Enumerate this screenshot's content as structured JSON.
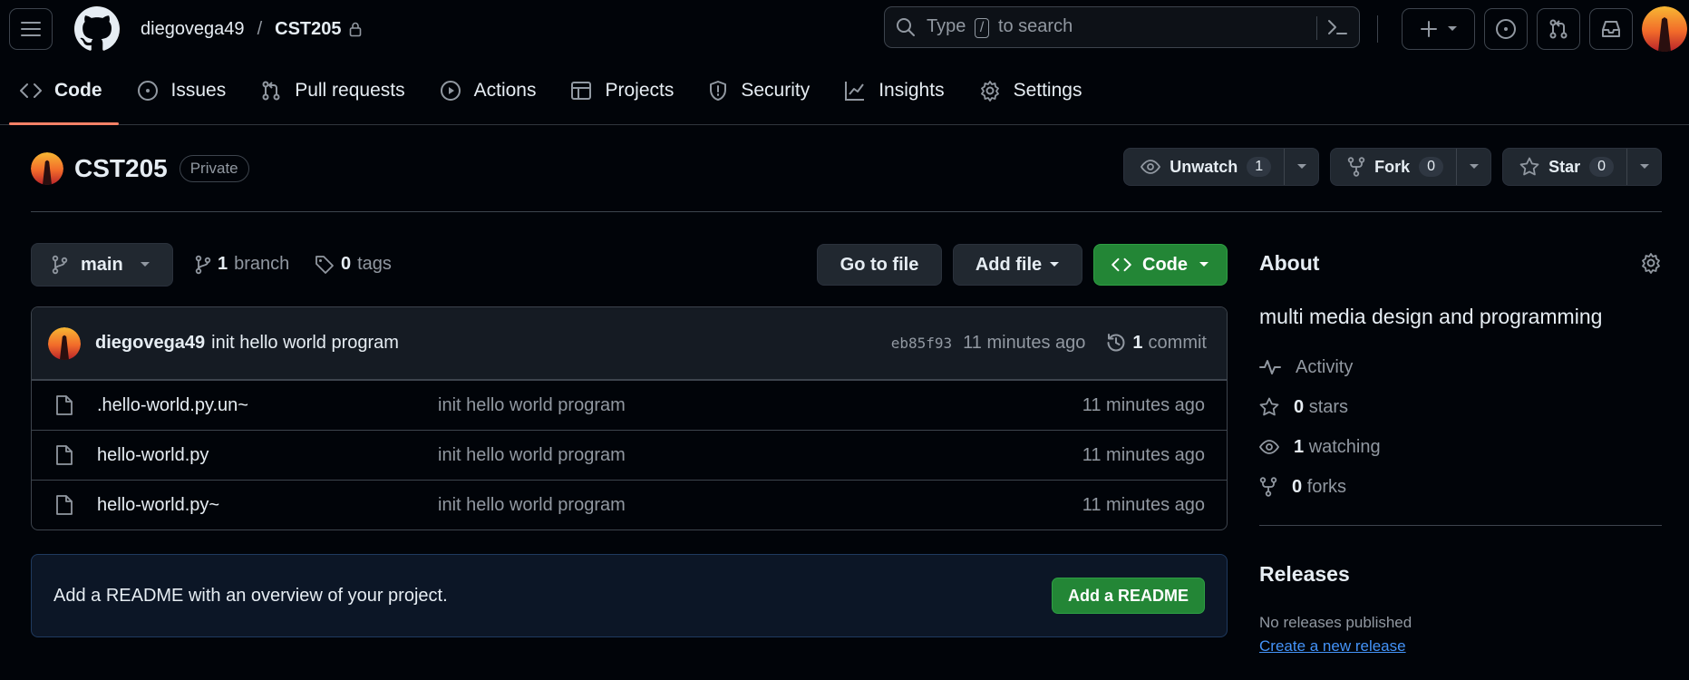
{
  "header": {
    "owner": "diegovega49",
    "separator": "/",
    "repo": "CST205",
    "search": {
      "pre": "Type",
      "key": "/",
      "post": "to search"
    }
  },
  "nav": {
    "code": "Code",
    "issues": "Issues",
    "pulls": "Pull requests",
    "actions": "Actions",
    "projects": "Projects",
    "security": "Security",
    "insights": "Insights",
    "settings": "Settings"
  },
  "repo": {
    "name": "CST205",
    "visibility": "Private",
    "watch": {
      "label": "Unwatch",
      "count": "1"
    },
    "fork": {
      "label": "Fork",
      "count": "0"
    },
    "star": {
      "label": "Star",
      "count": "0"
    }
  },
  "toolbar": {
    "branch": "main",
    "branch_count": "1",
    "branch_word": "branch",
    "tag_count": "0",
    "tag_word": "tags",
    "go_to_file": "Go to file",
    "add_file": "Add file",
    "code": "Code"
  },
  "commit": {
    "author": "diegovega49",
    "message": "init hello world program",
    "sha": "eb85f93",
    "time": "11 minutes ago",
    "count": "1",
    "count_word": "commit"
  },
  "files": [
    {
      "name": ".hello-world.py.un~",
      "message": "init hello world program",
      "time": "11 minutes ago"
    },
    {
      "name": "hello-world.py",
      "message": "init hello world program",
      "time": "11 minutes ago"
    },
    {
      "name": "hello-world.py~",
      "message": "init hello world program",
      "time": "11 minutes ago"
    }
  ],
  "readme": {
    "text": "Add a README with an overview of your project.",
    "button": "Add a README"
  },
  "about": {
    "title": "About",
    "description": "multi media design and programming",
    "activity": "Activity",
    "stars_count": "0",
    "stars_word": "stars",
    "watching_count": "1",
    "watching_word": "watching",
    "forks_count": "0",
    "forks_word": "forks"
  },
  "releases": {
    "title": "Releases",
    "none": "No releases published",
    "create": "Create a new release"
  },
  "colors": {
    "accent_green": "#238636",
    "link_blue": "#4493f8",
    "tab_underline": "#f78166",
    "background": "#010409"
  }
}
